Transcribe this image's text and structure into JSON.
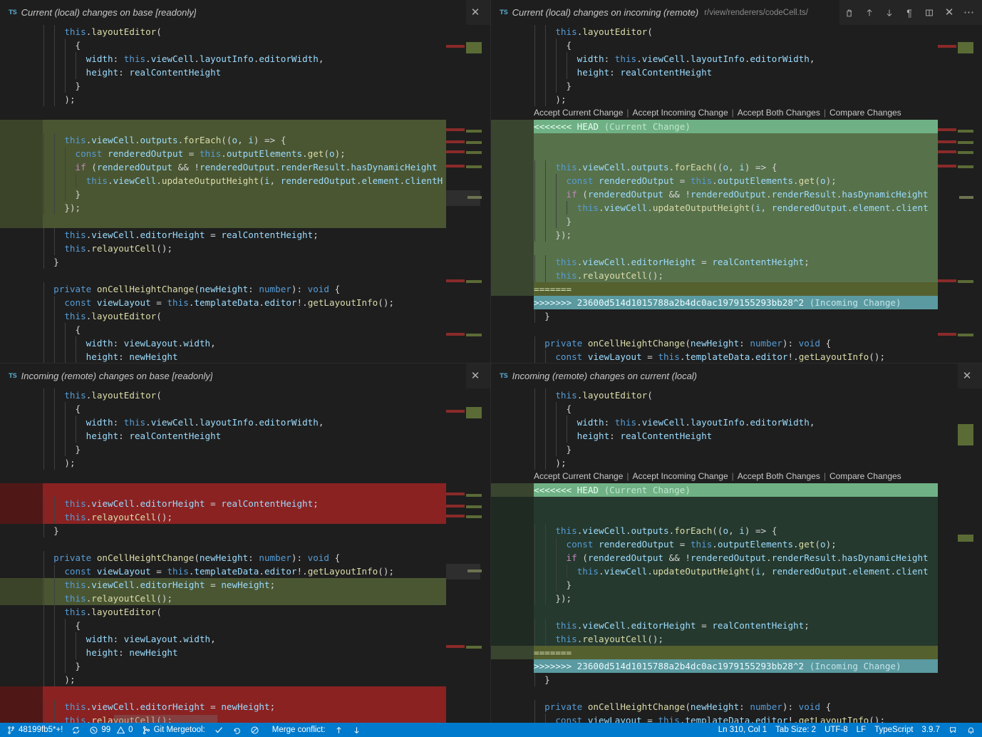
{
  "colors": {
    "accent": "#007acc",
    "editor_bg": "#1e1e1e",
    "tabbar_bg": "#252526",
    "current_change_header": "#6fb185",
    "incoming_change_header": "#5a9aa0",
    "current_block_light": "#57714b",
    "current_block_dark": "#25392e",
    "separator_olive": "#55602f",
    "diff_insert": "#4a5632",
    "diff_delete": "#8a2222",
    "ts_icon": "#519aba"
  },
  "panes": [
    {
      "id": "top-left",
      "icon": "typescript-file-icon",
      "title": "Current (local) changes on base [readonly]",
      "description": "",
      "actions": [
        "close"
      ]
    },
    {
      "id": "top-right",
      "icon": "typescript-file-icon",
      "title": "Current (local) changes on incoming (remote)",
      "description": "r/view/renderers/codeCell.ts/",
      "actions": [
        "split-editor-copy",
        "arrow-up",
        "arrow-down",
        "pilcrow",
        "split-editor",
        "close",
        "more"
      ]
    },
    {
      "id": "bottom-left",
      "icon": "typescript-file-icon",
      "title": "Incoming (remote) changes on base [readonly]",
      "description": "",
      "actions": [
        "close"
      ]
    },
    {
      "id": "bottom-right",
      "icon": "typescript-file-icon",
      "title": "Incoming (remote) changes on current (local)",
      "description": "",
      "actions": [
        "close"
      ]
    }
  ],
  "codelens": {
    "accept_current": "Accept Current Change",
    "accept_incoming": "Accept Incoming Change",
    "accept_both": "Accept Both Changes",
    "compare": "Compare Changes",
    "separator": "|"
  },
  "conflict_markers": {
    "head": "<<<<<<< HEAD",
    "head_label": "(Current Change)",
    "middle": "=======",
    "incoming": ">>>>>>> 23600d514d1015788a2b4dc0ac1979155293bb28^2",
    "incoming_label": "(Incoming Change)"
  },
  "code": {
    "top_left": [
      {
        "text": "    this.layoutEditor(",
        "hl": "none"
      },
      {
        "text": "      {",
        "hl": "none"
      },
      {
        "text": "        width: this.viewCell.layoutInfo.editorWidth,",
        "hl": "none"
      },
      {
        "text": "        height: realContentHeight",
        "hl": "none"
      },
      {
        "text": "      }",
        "hl": "none"
      },
      {
        "text": "    );",
        "hl": "none"
      },
      {
        "text": "",
        "hl": "none"
      },
      {
        "text": "",
        "hl": "green"
      },
      {
        "text": "    this.viewCell.outputs.forEach((o, i) => {",
        "hl": "green"
      },
      {
        "text": "      const renderedOutput = this.outputElements.get(o);",
        "hl": "green"
      },
      {
        "text": "      if (renderedOutput && !renderedOutput.renderResult.hasDynamicHeight",
        "hl": "green"
      },
      {
        "text": "        this.viewCell.updateOutputHeight(i, renderedOutput.element.clientH",
        "hl": "green"
      },
      {
        "text": "      }",
        "hl": "green"
      },
      {
        "text": "    });",
        "hl": "green"
      },
      {
        "text": "",
        "hl": "green"
      },
      {
        "text": "    this.viewCell.editorHeight = realContentHeight;",
        "hl": "none"
      },
      {
        "text": "    this.relayoutCell();",
        "hl": "none"
      },
      {
        "text": "  }",
        "hl": "none"
      },
      {
        "text": "",
        "hl": "none"
      },
      {
        "text": "  private onCellHeightChange(newHeight: number): void {",
        "hl": "none"
      },
      {
        "text": "    const viewLayout = this.templateData.editor!.getLayoutInfo();",
        "hl": "none"
      },
      {
        "text": "    this.layoutEditor(",
        "hl": "none"
      },
      {
        "text": "      {",
        "hl": "none"
      },
      {
        "text": "        width: viewLayout.width,",
        "hl": "none"
      },
      {
        "text": "        height: newHeight",
        "hl": "none"
      }
    ],
    "top_right": [
      {
        "text": "    this.layoutEditor(",
        "hl": "none"
      },
      {
        "text": "      {",
        "hl": "none"
      },
      {
        "text": "        width: this.viewCell.layoutInfo.editorWidth,",
        "hl": "none"
      },
      {
        "text": "        height: realContentHeight",
        "hl": "none"
      },
      {
        "text": "      }",
        "hl": "none"
      },
      {
        "text": "    );",
        "hl": "none"
      },
      {
        "text": "__CODELENS__",
        "hl": "codelens"
      },
      {
        "text": "<<<<<<< HEAD (Current Change)",
        "hl": "head"
      },
      {
        "text": "",
        "hl": "conflict"
      },
      {
        "text": "",
        "hl": "conflict"
      },
      {
        "text": "    this.viewCell.outputs.forEach((o, i) => {",
        "hl": "conflict"
      },
      {
        "text": "      const renderedOutput = this.outputElements.get(o);",
        "hl": "conflict"
      },
      {
        "text": "      if (renderedOutput && !renderedOutput.renderResult.hasDynamicHeight",
        "hl": "conflict"
      },
      {
        "text": "        this.viewCell.updateOutputHeight(i, renderedOutput.element.client",
        "hl": "conflict"
      },
      {
        "text": "      }",
        "hl": "conflict"
      },
      {
        "text": "    });",
        "hl": "conflict"
      },
      {
        "text": "",
        "hl": "conflict"
      },
      {
        "text": "    this.viewCell.editorHeight = realContentHeight;",
        "hl": "conflict"
      },
      {
        "text": "    this.relayoutCell();",
        "hl": "conflict"
      },
      {
        "text": "=======",
        "hl": "sep"
      },
      {
        "text": ">>>>>>> 23600d514d1015788a2b4dc0ac1979155293bb28^2 (Incoming Change)",
        "hl": "incoming"
      },
      {
        "text": "  }",
        "hl": "none"
      },
      {
        "text": "",
        "hl": "none"
      },
      {
        "text": "  private onCellHeightChange(newHeight: number): void {",
        "hl": "none"
      },
      {
        "text": "    const viewLayout = this.templateData.editor!.getLayoutInfo();",
        "hl": "none"
      }
    ],
    "bottom_left": [
      {
        "text": "    this.layoutEditor(",
        "hl": "none"
      },
      {
        "text": "      {",
        "hl": "none"
      },
      {
        "text": "        width: this.viewCell.layoutInfo.editorWidth,",
        "hl": "none"
      },
      {
        "text": "        height: realContentHeight",
        "hl": "none"
      },
      {
        "text": "      }",
        "hl": "none"
      },
      {
        "text": "    );",
        "hl": "none"
      },
      {
        "text": "",
        "hl": "none"
      },
      {
        "text": "",
        "hl": "red"
      },
      {
        "text": "    this.viewCell.editorHeight = realContentHeight;",
        "hl": "red"
      },
      {
        "text": "    this.relayoutCell();",
        "hl": "red"
      },
      {
        "text": "  }",
        "hl": "none"
      },
      {
        "text": "",
        "hl": "none"
      },
      {
        "text": "  private onCellHeightChange(newHeight: number): void {",
        "hl": "none"
      },
      {
        "text": "    const viewLayout = this.templateData.editor!.getLayoutInfo();",
        "hl": "none"
      },
      {
        "text": "    this.viewCell.editorHeight = newHeight;",
        "hl": "green"
      },
      {
        "text": "    this.relayoutCell();",
        "hl": "green"
      },
      {
        "text": "    this.layoutEditor(",
        "hl": "none"
      },
      {
        "text": "      {",
        "hl": "none"
      },
      {
        "text": "        width: viewLayout.width,",
        "hl": "none"
      },
      {
        "text": "        height: newHeight",
        "hl": "none"
      },
      {
        "text": "      }",
        "hl": "none"
      },
      {
        "text": "    );",
        "hl": "none"
      },
      {
        "text": "",
        "hl": "red"
      },
      {
        "text": "    this.viewCell.editorHeight = newHeight;",
        "hl": "red"
      },
      {
        "text": "    this.relayoutCell();",
        "hl": "red"
      },
      {
        "text": "  }",
        "hl": "none"
      }
    ],
    "bottom_right": [
      {
        "text": "    this.layoutEditor(",
        "hl": "none"
      },
      {
        "text": "      {",
        "hl": "none"
      },
      {
        "text": "        width: this.viewCell.layoutInfo.editorWidth,",
        "hl": "none"
      },
      {
        "text": "        height: realContentHeight",
        "hl": "none"
      },
      {
        "text": "      }",
        "hl": "none"
      },
      {
        "text": "    );",
        "hl": "none"
      },
      {
        "text": "__CODELENS__",
        "hl": "codelens"
      },
      {
        "text": "<<<<<<< HEAD (Current Change)",
        "hl": "head"
      },
      {
        "text": "",
        "hl": "conflict-dk"
      },
      {
        "text": "",
        "hl": "conflict-dk"
      },
      {
        "text": "    this.viewCell.outputs.forEach((o, i) => {",
        "hl": "conflict-dk"
      },
      {
        "text": "      const renderedOutput = this.outputElements.get(o);",
        "hl": "conflict-dk"
      },
      {
        "text": "      if (renderedOutput && !renderedOutput.renderResult.hasDynamicHeight",
        "hl": "conflict-dk"
      },
      {
        "text": "        this.viewCell.updateOutputHeight(i, renderedOutput.element.client",
        "hl": "conflict-dk"
      },
      {
        "text": "      }",
        "hl": "conflict-dk"
      },
      {
        "text": "    });",
        "hl": "conflict-dk"
      },
      {
        "text": "",
        "hl": "conflict-dk"
      },
      {
        "text": "    this.viewCell.editorHeight = realContentHeight;",
        "hl": "conflict-dk"
      },
      {
        "text": "    this.relayoutCell();",
        "hl": "conflict-dk"
      },
      {
        "text": "=======",
        "hl": "sep"
      },
      {
        "text": ">>>>>>> 23600d514d1015788a2b4dc0ac1979155293bb28^2 (Incoming Change)",
        "hl": "incoming"
      },
      {
        "text": "  }",
        "hl": "none"
      },
      {
        "text": "",
        "hl": "none"
      },
      {
        "text": "  private onCellHeightChange(newHeight: number): void {",
        "hl": "none"
      },
      {
        "text": "    const viewLayout = this.templateData.editor!.getLayoutInfo();",
        "hl": "none"
      }
    ]
  },
  "status_bar": {
    "left": [
      {
        "name": "branch",
        "icon": "source-control-icon",
        "label": "48199fb5*+!"
      },
      {
        "name": "sync",
        "icon": "sync-icon",
        "label": ""
      },
      {
        "name": "problems",
        "icon": "error-icon",
        "label": "99",
        "icon2": "warning-icon",
        "label2": "0"
      },
      {
        "name": "git-mergetool",
        "icon": "git-merge-icon",
        "label": "Git Mergetool:"
      },
      {
        "name": "mergetool-accept",
        "icon": "check-icon",
        "label": ""
      },
      {
        "name": "mergetool-refresh",
        "icon": "discard-icon",
        "label": ""
      },
      {
        "name": "mergetool-abort",
        "icon": "circle-slash-icon",
        "label": ""
      },
      {
        "name": "merge-conflict",
        "icon": "",
        "label": "Merge conflict:"
      },
      {
        "name": "conflict-prev",
        "icon": "arrow-up-icon",
        "label": ""
      },
      {
        "name": "conflict-next",
        "icon": "arrow-down-icon",
        "label": ""
      }
    ],
    "right": [
      {
        "name": "cursor-position",
        "label": "Ln 310, Col 1"
      },
      {
        "name": "tab-size",
        "label": "Tab Size: 2"
      },
      {
        "name": "encoding",
        "label": "UTF-8"
      },
      {
        "name": "eol",
        "label": "LF"
      },
      {
        "name": "language-mode",
        "label": "TypeScript"
      },
      {
        "name": "ts-version",
        "label": "3.9.7"
      },
      {
        "name": "feedback",
        "icon": "feedback-icon",
        "label": ""
      },
      {
        "name": "notifications",
        "icon": "bell-icon",
        "label": ""
      }
    ]
  }
}
